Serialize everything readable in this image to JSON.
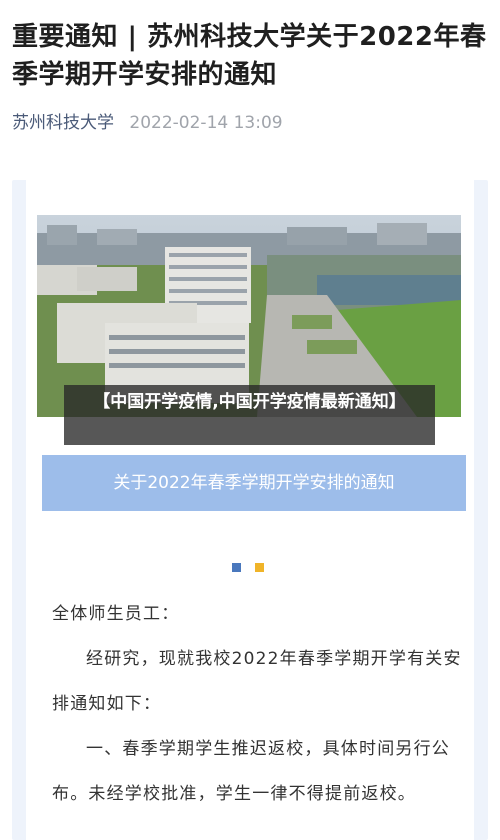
{
  "article": {
    "title": "重要通知 | 苏州科技大学关于2022年春季学期开学安排的通知",
    "author": "苏州科技大学",
    "date": "2022-02-14 13:09"
  },
  "image_caption": "【中国开学疫情,中国开学疫情最新通知】",
  "banner": {
    "text": "关于2022年春季学期开学安排的通知"
  },
  "colors": {
    "dot1": "#4a78bd",
    "dot2": "#f0b429",
    "banner": "#9dbdea"
  },
  "body": {
    "greeting": "全体师生员工：",
    "para1": "经研究，现就我校2022年春季学期开学有关安排通知如下：",
    "para2": "一、春季学期学生推迟返校，具体时间另行公布。未经学校批准，学生一律不得提前返校。"
  }
}
